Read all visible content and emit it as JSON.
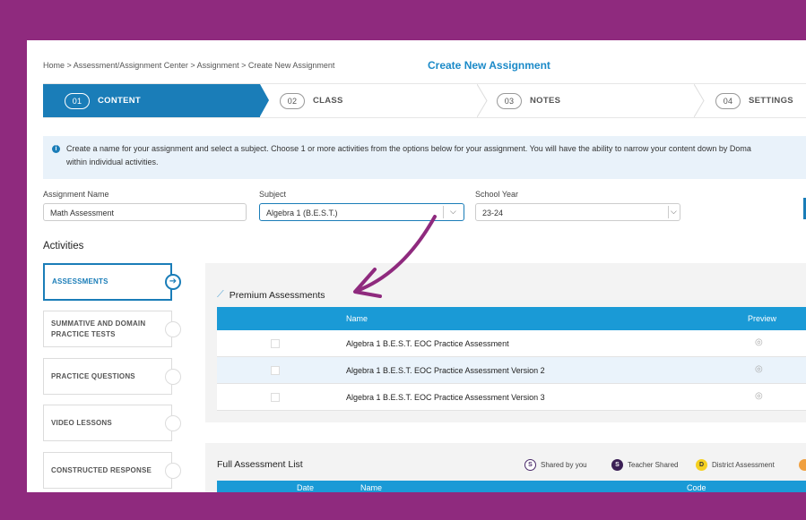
{
  "breadcrumb": "Home > Assessment/Assignment Center > Assignment > Create New Assignment",
  "page_heading": "Create New Assignment",
  "steps": [
    {
      "num": "01",
      "label": "CONTENT"
    },
    {
      "num": "02",
      "label": "CLASS"
    },
    {
      "num": "03",
      "label": "NOTES"
    },
    {
      "num": "04",
      "label": "SETTINGS"
    }
  ],
  "info_line1": "Create a name for your assignment and select a subject. Choose 1 or more activities from the options below for your assignment. You will have the ability to narrow your content down by Doma",
  "info_line2": "within individual activities.",
  "form": {
    "name_label": "Assignment Name",
    "name_value": "Math Assessment",
    "subject_label": "Subject",
    "subject_value": "Algebra 1 (B.E.S.T.)",
    "year_label": "School Year",
    "year_value": "23-24"
  },
  "activities_title": "Activities",
  "tabs": [
    {
      "label": "ASSESSMENTS"
    },
    {
      "label": "SUMMATIVE AND DOMAIN PRACTICE TESTS"
    },
    {
      "label": "PRACTICE QUESTIONS"
    },
    {
      "label": "VIDEO LESSONS"
    },
    {
      "label": "CONSTRUCTED RESPONSE"
    }
  ],
  "premium": {
    "title": "Premium Assessments",
    "col_name": "Name",
    "col_preview": "Preview",
    "rows": [
      {
        "name": "Algebra 1 B.E.S.T. EOC Practice Assessment"
      },
      {
        "name": "Algebra 1 B.E.S.T. EOC Practice Assessment Version 2"
      },
      {
        "name": "Algebra 1 B.E.S.T. EOC Practice Assessment Version 3"
      }
    ]
  },
  "full_list": {
    "title": "Full Assessment List",
    "legend": [
      {
        "badge": "S",
        "label": "Shared by you"
      },
      {
        "badge": "S",
        "label": "Teacher Shared"
      },
      {
        "badge": "D",
        "label": "District Assessment"
      }
    ],
    "col_date": "Date",
    "col_name": "Name",
    "col_code": "Code"
  },
  "colors": {
    "accent": "#1a7db8",
    "frame_bg": "#8f2a7e",
    "table_header": "#1a9ad6"
  }
}
